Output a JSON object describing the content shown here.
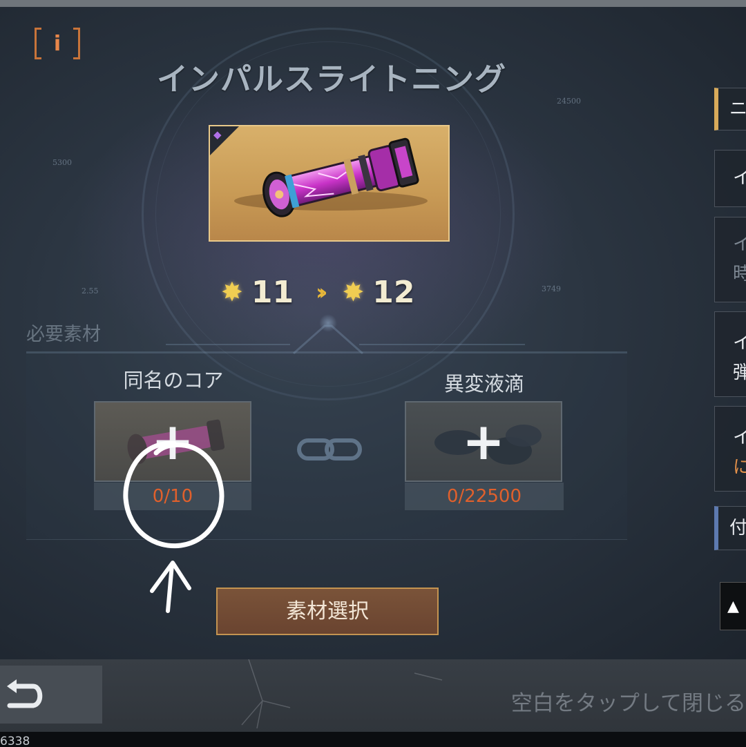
{
  "screen": {
    "title": "インパルスライトニング",
    "info_button": "i",
    "hud_numbers": [
      "24500",
      "5300",
      "2.55",
      "3749"
    ]
  },
  "upgrade": {
    "from_stars": "11",
    "to_stars": "12",
    "star_icon": "star-icon",
    "arrow_icon": "double-chevron-right-icon"
  },
  "materials": {
    "section_label": "必要素材",
    "items": [
      {
        "label": "同名のコア",
        "count": "0/10",
        "icon": "plus-icon"
      },
      {
        "label": "異変液滴",
        "count": "0/22500",
        "icon": "plus-icon"
      }
    ]
  },
  "buttons": {
    "select_material": "素材選択"
  },
  "right_panel": {
    "tab1": "ニ",
    "tab2": "イ",
    "tab3_line1": "イ",
    "tab3_line2": "時",
    "tab4_line1": "イ",
    "tab4_line2": "弾",
    "tab5_line1": "イ",
    "tab5_line2": "に",
    "tab6": "付"
  },
  "footer": {
    "close_hint": "空白をタップして閉じる",
    "uid": "6338"
  },
  "colors": {
    "accent_orange": "#e0602c",
    "star_gold": "#f0cd52",
    "button_border": "#c49451",
    "item_card_bg": "#d8b06a"
  }
}
